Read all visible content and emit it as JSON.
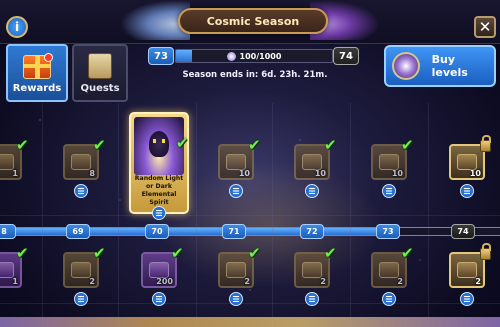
{
  "window": {
    "title": "Cosmic Season"
  },
  "tabs": [
    {
      "label": "Rewards",
      "icon": "gift-icon",
      "active": true,
      "notification": true
    },
    {
      "label": "Quests",
      "icon": "scroll-icon",
      "active": false
    }
  ],
  "progress": {
    "current_level": "73",
    "next_level": "74",
    "points_text": "100/1000",
    "fill_fraction": 0.1,
    "season_ends": "Season ends in: 6d. 23h. 21m."
  },
  "buy_button": {
    "label": "Buy levels"
  },
  "featured_reward": {
    "label": "Random Light or Dark Elemental Spirit"
  },
  "track": {
    "levels": [
      "8",
      "69",
      "70",
      "71",
      "72",
      "73",
      "74"
    ],
    "fill_fraction": 0.79
  },
  "top_row": [
    {
      "count": "1",
      "claimed": true,
      "type": "gold"
    },
    {
      "count": "8",
      "claimed": true,
      "type": "gold"
    },
    {
      "count": "",
      "claimed": true,
      "type": "featured"
    },
    {
      "count": "10",
      "claimed": true,
      "type": "gold"
    },
    {
      "count": "10",
      "claimed": true,
      "type": "gold"
    },
    {
      "count": "10",
      "claimed": true,
      "type": "gold"
    },
    {
      "count": "10",
      "claimed": false,
      "locked": true,
      "type": "gold"
    }
  ],
  "bottom_row": [
    {
      "count": "1",
      "claimed": true,
      "type": "purple"
    },
    {
      "count": "2",
      "claimed": true,
      "type": "gold"
    },
    {
      "count": "200",
      "claimed": true,
      "type": "purple"
    },
    {
      "count": "2",
      "claimed": true,
      "type": "gold"
    },
    {
      "count": "2",
      "claimed": true,
      "type": "gold"
    },
    {
      "count": "2",
      "claimed": true,
      "type": "gold"
    },
    {
      "count": "2",
      "claimed": false,
      "locked": true,
      "type": "gold"
    }
  ],
  "colors": {
    "accent_blue": "#2b6fd0",
    "check_green": "#6ff04a",
    "title_gold": "#c99a52"
  }
}
